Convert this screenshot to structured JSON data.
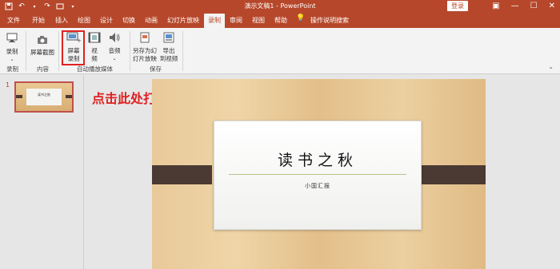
{
  "app": {
    "title": "演示文稿1 - PowerPoint",
    "login_label": "登录"
  },
  "qat": {
    "save_icon": "save-icon",
    "undo_icon": "undo-icon",
    "redo_icon": "redo-icon",
    "customize_icon": "customize-icon"
  },
  "tabs": [
    "文件",
    "开始",
    "插入",
    "绘图",
    "设计",
    "切换",
    "动画",
    "幻灯片放映",
    "录制",
    "审阅",
    "视图",
    "帮助"
  ],
  "active_tab": "录制",
  "tell_me": "操作说明搜索",
  "ribbon": {
    "record_label": "录制",
    "screenshot_label": "屏幕截图",
    "screen_record_label1": "屏幕",
    "screen_record_label2": "录制",
    "video_label1": "视",
    "video_label2": "频",
    "audio_label": "音频",
    "save_as_show_label1": "另存为幻",
    "save_as_show_label2": "灯片放映",
    "export_video_label1": "导出",
    "export_video_label2": "到视频",
    "groups": [
      "录制",
      "内容",
      "自动播放媒体",
      "保存"
    ]
  },
  "thumbnail": {
    "slide_number": "1"
  },
  "annotation": "点击此处打开录制窗口",
  "slide": {
    "title": "读书之秋",
    "subtitle": "小国汇报"
  },
  "colors": {
    "accent": "#b7472a",
    "highlight": "#e02020"
  }
}
